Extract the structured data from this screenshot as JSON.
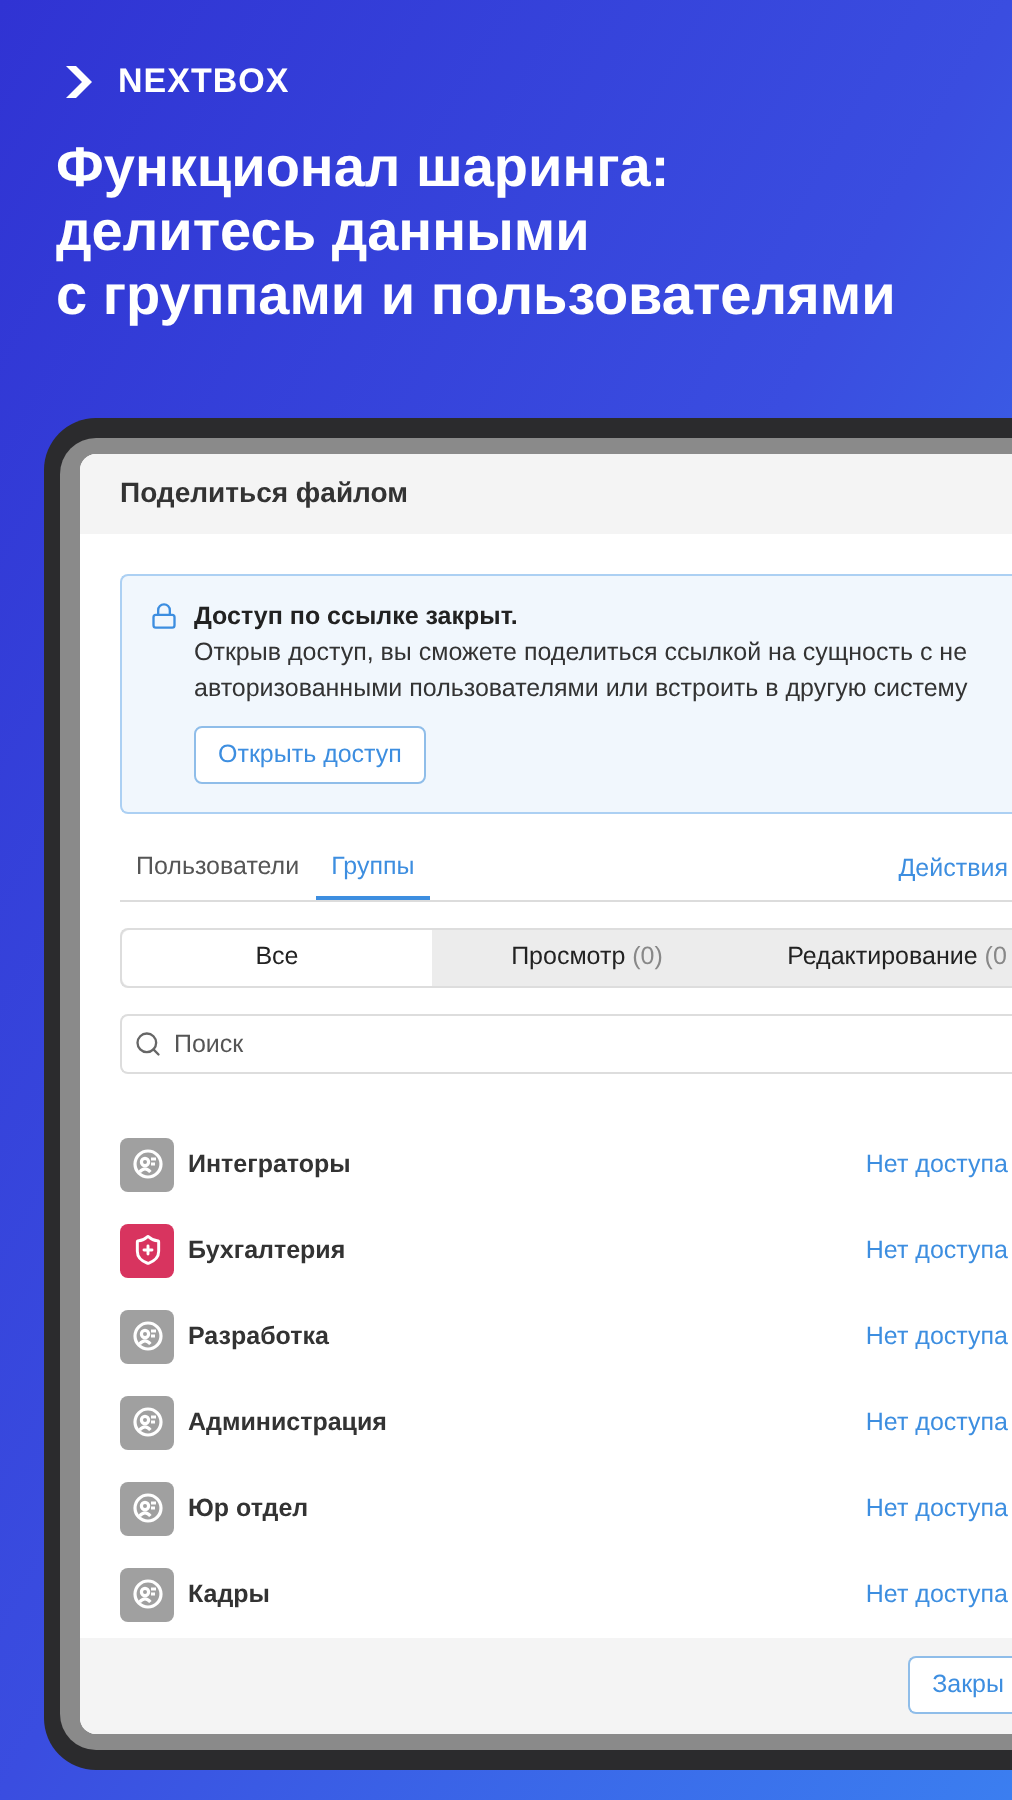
{
  "brand": {
    "name": "NEXTBOX"
  },
  "headline": [
    "Функционал шаринга:",
    "делитесь данными",
    "с группами и пользователями"
  ],
  "dialog": {
    "title": "Поделиться файлом",
    "notice": {
      "title": "Доступ по ссылке закрыт.",
      "text": "Открыв доступ, вы сможете поделиться ссылкой на сущность с не авторизованными пользователями или встроить в другую систему",
      "button": "Открыть доступ"
    },
    "tabs": [
      {
        "label": "Пользователи",
        "selected": false
      },
      {
        "label": "Группы",
        "selected": true
      }
    ],
    "actions": "Действия",
    "filters": [
      {
        "label": "Все",
        "selected": true
      },
      {
        "label": "Просмотр",
        "count": "(0)",
        "selected": false
      },
      {
        "label": "Редактирование",
        "count": "(0",
        "selected": false
      }
    ],
    "search": {
      "placeholder": "Поиск"
    },
    "groups": [
      {
        "name": "Интеграторы",
        "kind": "group",
        "access": "Нет доступа"
      },
      {
        "name": "Бухгалтерия",
        "kind": "shield",
        "access": "Нет доступа"
      },
      {
        "name": "Разработка",
        "kind": "group",
        "access": "Нет доступа"
      },
      {
        "name": "Администрация",
        "kind": "group",
        "access": "Нет доступа"
      },
      {
        "name": "Юр отдел",
        "kind": "group",
        "access": "Нет доступа"
      },
      {
        "name": "Кадры",
        "kind": "group",
        "access": "Нет доступа"
      }
    ],
    "footer_button": "Закры"
  }
}
